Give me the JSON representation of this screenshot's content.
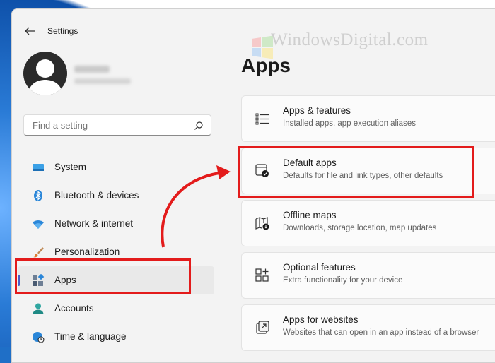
{
  "window": {
    "title": "Settings"
  },
  "watermark": "WindowsDigital.com",
  "search": {
    "placeholder": "Find a setting"
  },
  "nav": {
    "items": [
      {
        "label": "System",
        "icon": "monitor-icon"
      },
      {
        "label": "Bluetooth & devices",
        "icon": "bluetooth-icon"
      },
      {
        "label": "Network & internet",
        "icon": "wifi-icon"
      },
      {
        "label": "Personalization",
        "icon": "brush-icon"
      },
      {
        "label": "Apps",
        "icon": "apps-icon",
        "active": true
      },
      {
        "label": "Accounts",
        "icon": "account-icon"
      },
      {
        "label": "Time & language",
        "icon": "globe-clock-icon"
      }
    ]
  },
  "page": {
    "title": "Apps"
  },
  "cards": [
    {
      "title": "Apps & features",
      "subtitle": "Installed apps, app execution aliases",
      "icon": "list-icon"
    },
    {
      "title": "Default apps",
      "subtitle": "Defaults for file and link types, other defaults",
      "icon": "default-apps-icon"
    },
    {
      "title": "Offline maps",
      "subtitle": "Downloads, storage location, map updates",
      "icon": "map-icon"
    },
    {
      "title": "Optional features",
      "subtitle": "Extra functionality for your device",
      "icon": "optional-features-icon"
    },
    {
      "title": "Apps for websites",
      "subtitle": "Websites that can open in an app instead of a browser",
      "icon": "open-external-icon"
    }
  ],
  "colors": {
    "accent": "#4a5ec8",
    "highlight": "#e31b1b"
  }
}
